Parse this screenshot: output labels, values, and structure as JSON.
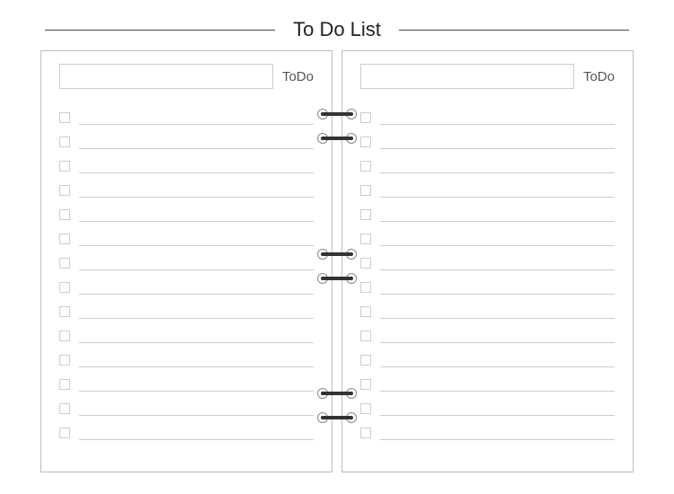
{
  "header": {
    "title": "To Do List"
  },
  "left": {
    "title_value": "",
    "label": "ToDo",
    "rows": [
      {
        "checked": false,
        "text": ""
      },
      {
        "checked": false,
        "text": ""
      },
      {
        "checked": false,
        "text": ""
      },
      {
        "checked": false,
        "text": ""
      },
      {
        "checked": false,
        "text": ""
      },
      {
        "checked": false,
        "text": ""
      },
      {
        "checked": false,
        "text": ""
      },
      {
        "checked": false,
        "text": ""
      },
      {
        "checked": false,
        "text": ""
      },
      {
        "checked": false,
        "text": ""
      },
      {
        "checked": false,
        "text": ""
      },
      {
        "checked": false,
        "text": ""
      },
      {
        "checked": false,
        "text": ""
      },
      {
        "checked": false,
        "text": ""
      }
    ]
  },
  "right": {
    "title_value": "",
    "label": "ToDo",
    "rows": [
      {
        "checked": false,
        "text": ""
      },
      {
        "checked": false,
        "text": ""
      },
      {
        "checked": false,
        "text": ""
      },
      {
        "checked": false,
        "text": ""
      },
      {
        "checked": false,
        "text": ""
      },
      {
        "checked": false,
        "text": ""
      },
      {
        "checked": false,
        "text": ""
      },
      {
        "checked": false,
        "text": ""
      },
      {
        "checked": false,
        "text": ""
      },
      {
        "checked": false,
        "text": ""
      },
      {
        "checked": false,
        "text": ""
      },
      {
        "checked": false,
        "text": ""
      },
      {
        "checked": false,
        "text": ""
      },
      {
        "checked": false,
        "text": ""
      }
    ]
  },
  "binding": {
    "pairs": 3,
    "rings_per_pair": 2
  }
}
